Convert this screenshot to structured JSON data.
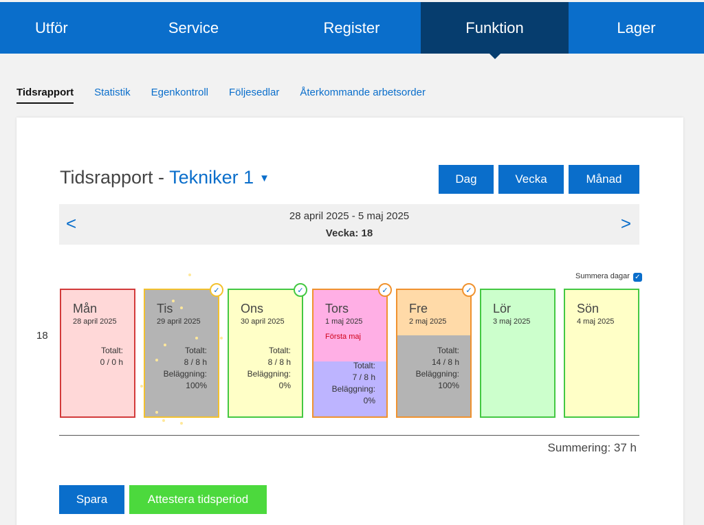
{
  "topnav": {
    "items": [
      {
        "label": "Utför"
      },
      {
        "label": "Service"
      },
      {
        "label": "Register"
      },
      {
        "label": "Funktion",
        "active": true
      },
      {
        "label": "Lager"
      }
    ]
  },
  "subtabs": {
    "items": [
      {
        "label": "Tidsrapport",
        "active": true
      },
      {
        "label": "Statistik"
      },
      {
        "label": "Egenkontroll"
      },
      {
        "label": "Följesedlar"
      },
      {
        "label": "Återkommande arbetsorder"
      }
    ]
  },
  "header": {
    "title": "Tidsrapport - ",
    "technician": "Tekniker 1",
    "caret": "▼"
  },
  "view_buttons": {
    "dag": "Dag",
    "vecka": "Vecka",
    "manad": "Månad"
  },
  "period": {
    "range": "28 april 2025 - 5 maj 2025",
    "week": "Vecka: 18",
    "prev": "<",
    "next": ">"
  },
  "summera": {
    "label": "Summera dagar",
    "checked": true
  },
  "week_number": "18",
  "days": [
    {
      "name": "Mån",
      "date": "28 april 2025",
      "totalt_label": "Totalt:",
      "totalt": "0 / 0 h"
    },
    {
      "name": "Tis",
      "date": "29 april 2025",
      "totalt_label": "Totalt:",
      "totalt": "8 / 8 h",
      "belaggning_label": "Beläggning:",
      "belaggning": "100%",
      "attested": true
    },
    {
      "name": "Ons",
      "date": "30 april 2025",
      "totalt_label": "Totalt:",
      "totalt": "8 / 8 h",
      "belaggning_label": "Beläggning:",
      "belaggning": "0%",
      "attested": true
    },
    {
      "name": "Tors",
      "date": "1 maj 2025",
      "holiday": "Första maj",
      "totalt_label": "Totalt:",
      "totalt": "7 / 8 h",
      "belaggning_label": "Beläggning:",
      "belaggning": "0%",
      "attested": true
    },
    {
      "name": "Fre",
      "date": "2 maj 2025",
      "totalt_label": "Totalt:",
      "totalt": "14 / 8 h",
      "belaggning_label": "Beläggning:",
      "belaggning": "100%",
      "attested": true
    },
    {
      "name": "Lör",
      "date": "3 maj 2025"
    },
    {
      "name": "Sön",
      "date": "4 maj 2025"
    }
  ],
  "check_glyph": "✓",
  "summering": "Summering: 37 h",
  "actions": {
    "spara": "Spara",
    "attestera": "Attestera tidsperiod"
  },
  "colors": {
    "primary": "#0a6ecb",
    "nav_active": "#063d6e",
    "attest_green": "#4cd93d"
  }
}
